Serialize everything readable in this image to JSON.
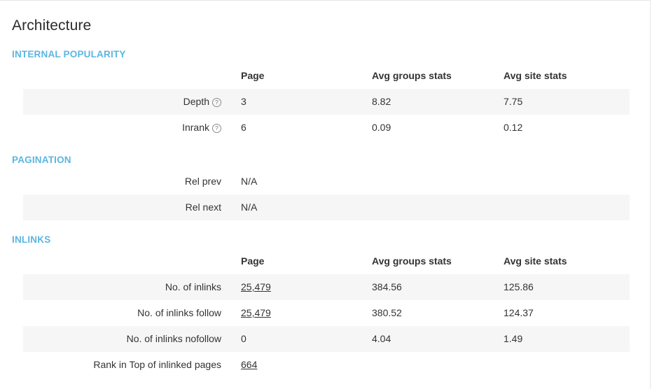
{
  "title": "Architecture",
  "sections": {
    "internal_popularity": {
      "title": "INTERNAL POPULARITY",
      "headers": {
        "page": "Page",
        "group": "Avg groups stats",
        "site": "Avg site stats"
      },
      "rows": [
        {
          "label": "Depth",
          "page": "3",
          "group": "8.82",
          "site": "7.75"
        },
        {
          "label": "Inrank",
          "page": "6",
          "group": "0.09",
          "site": "0.12"
        }
      ]
    },
    "pagination": {
      "title": "PAGINATION",
      "rows": [
        {
          "label": "Rel prev",
          "page": "N/A"
        },
        {
          "label": "Rel next",
          "page": "N/A"
        }
      ]
    },
    "inlinks": {
      "title": "INLINKS",
      "headers": {
        "page": "Page",
        "group": "Avg groups stats",
        "site": "Avg site stats"
      },
      "rows": [
        {
          "label": "No. of inlinks",
          "page": "25,479",
          "group": "384.56",
          "site": "125.86"
        },
        {
          "label": "No. of inlinks follow",
          "page": "25,479",
          "group": "380.52",
          "site": "124.37"
        },
        {
          "label": "No. of inlinks nofollow",
          "page": "0",
          "group": "4.04",
          "site": "1.49"
        },
        {
          "label": "Rank in Top of inlinked pages",
          "page": "664"
        }
      ]
    }
  },
  "icons": {
    "help": "help-circle-icon",
    "help_glyph": "?"
  },
  "colors": {
    "section_title": "#5bb6e0",
    "stripe": "#f6f6f6"
  }
}
